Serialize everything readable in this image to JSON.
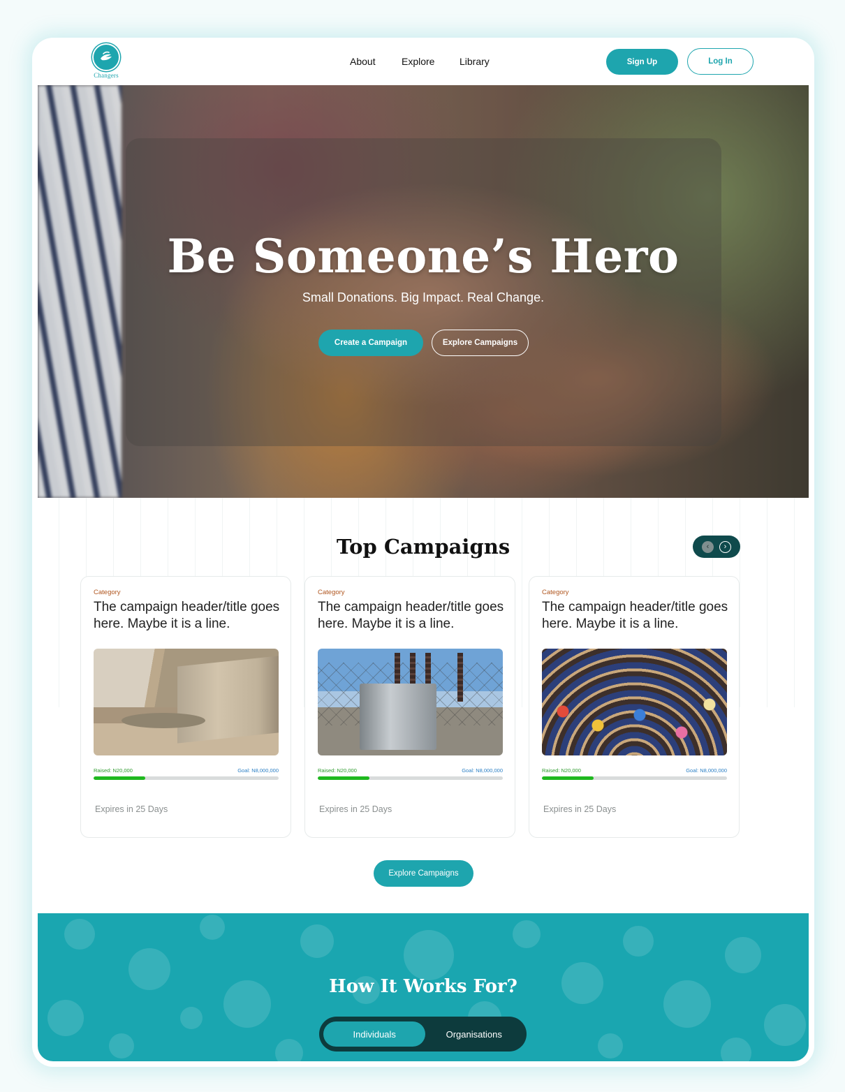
{
  "brand": {
    "name": "Changers",
    "accent": "#1ea5ae"
  },
  "nav": {
    "links": [
      "About",
      "Explore",
      "Library"
    ],
    "signup": "Sign Up",
    "login": "Log In"
  },
  "hero": {
    "title": "Be Someone’s Hero",
    "subtitle": "Small Donations. Big Impact. Real Change.",
    "create_button": "Create a Campaign",
    "explore_button": "Explore Campaigns"
  },
  "campaigns": {
    "title": "Top Campaigns",
    "prev_icon": "chevron-left-icon",
    "next_icon": "chevron-right-icon",
    "items": [
      {
        "category": "Category",
        "title": "The campaign header/title goes here. Maybe it is a line.",
        "image": "street-scene",
        "raised": "Raised: N20,000",
        "goal": "Goal: N8,000,000",
        "progress": 0.28,
        "expires": "Expires in 25 Days"
      },
      {
        "category": "Category",
        "title": "The campaign header/title goes here. Maybe it is a line.",
        "image": "power-substation",
        "raised": "Raised: N20,000",
        "goal": "Goal: N8,000,000",
        "progress": 0.28,
        "expires": "Expires in 25 Days"
      },
      {
        "category": "Category",
        "title": "The campaign header/title goes here. Maybe it is a line.",
        "image": "classroom-children",
        "raised": "Raised: N20,000",
        "goal": "Goal: N8,000,000",
        "progress": 0.28,
        "expires": "Expires in 25 Days"
      }
    ],
    "explore_button": "Explore Campaigns"
  },
  "how": {
    "title": "How It Works For?",
    "tabs": [
      "Individuals",
      "Organisations"
    ],
    "active_tab": "Individuals"
  }
}
